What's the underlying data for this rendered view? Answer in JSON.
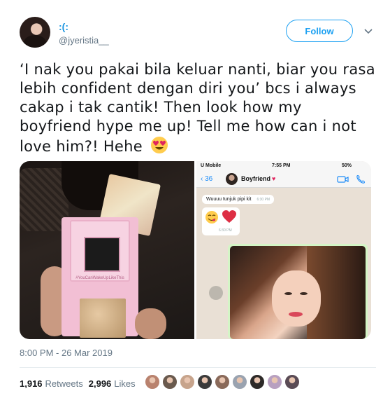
{
  "author": {
    "display_name": ":(:",
    "username": "@jyeristia__",
    "avatar_icon": "avatar"
  },
  "follow_button": {
    "label": "Follow"
  },
  "menu_icon": "chevron-down-icon",
  "tweet": {
    "text": "‘I nak you pakai bila keluar nanti, biar you rasa lebih confident dengan diri you’ bcs i always cakap i tak cantik! Then look how my boyfriend hype me up! Tell me how can i not love him?! Hehe",
    "emoji": "heart-eyes-emoji"
  },
  "media": {
    "left_photo": {
      "compact_text": "#YouCanWakeUpLikeThis"
    },
    "right_photo": {
      "status_bar": {
        "carrier": "U Mobile",
        "time": "7:55 PM",
        "battery": "50%"
      },
      "back_count": "36",
      "chat_name": "Boyfriend",
      "message_1": "Wuuuu tunjuk pipi kit",
      "message_1_time": "6:30 PM",
      "message_2_time": "6:30 PM"
    }
  },
  "timestamp": "8:00 PM - 26 Mar 2019",
  "stats": {
    "retweets_count": "1,916",
    "retweets_label": "Retweets",
    "likes_count": "2,996",
    "likes_label": "Likes"
  },
  "likers_colors": [
    "#b9826e",
    "#6a5a4e",
    "#c7a48c",
    "#3b3b3b",
    "#8a6a5a",
    "#9aa3b0",
    "#2d2a28",
    "#b8a0c0",
    "#5a4b55"
  ]
}
